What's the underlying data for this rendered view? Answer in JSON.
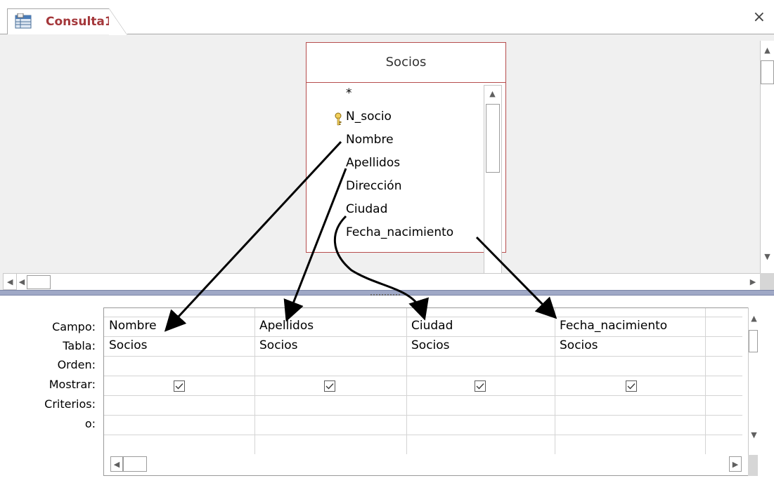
{
  "tab": {
    "label": "Consulta1",
    "close": "×"
  },
  "table": {
    "name": "Socios",
    "fields": [
      "*",
      "N_socio",
      "Nombre",
      "Apellidos",
      "Dirección",
      "Ciudad",
      "Fecha_nacimiento"
    ]
  },
  "grid": {
    "row_labels": [
      "Campo:",
      "Tabla:",
      "Orden:",
      "Mostrar:",
      "Criterios:",
      "o:"
    ],
    "columns": [
      {
        "campo": "Nombre",
        "tabla": "Socios",
        "mostrar": true
      },
      {
        "campo": "Apellidos",
        "tabla": "Socios",
        "mostrar": true
      },
      {
        "campo": "Ciudad",
        "tabla": "Socios",
        "mostrar": true
      },
      {
        "campo": "Fecha_nacimiento",
        "tabla": "Socios",
        "mostrar": true
      }
    ]
  },
  "colors": {
    "accent": "#a4373a",
    "table_border": "#b64d4d",
    "splitter": "#9fa8c6"
  }
}
